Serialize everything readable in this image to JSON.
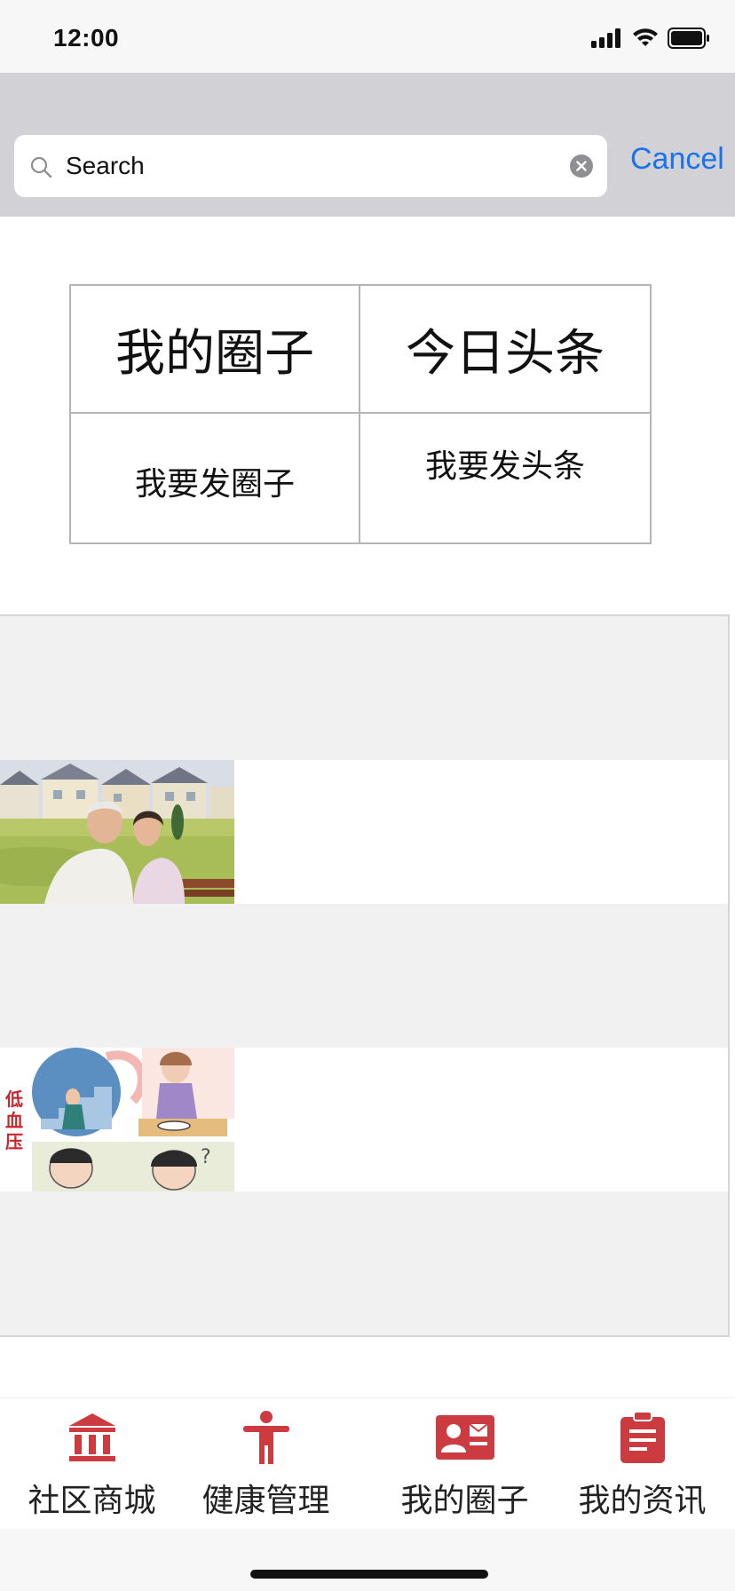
{
  "status_bar": {
    "time": "12:00"
  },
  "search": {
    "placeholder": "Search",
    "cancel_label": "Cancel"
  },
  "grid": {
    "my_circle": "我的圈子",
    "today_headlines": "今日头条",
    "post_circle": "我要发圈子",
    "post_headline": "我要发头条"
  },
  "feed": {
    "items": [
      {
        "thumbnail": "elderly-couple-park-photo"
      },
      {
        "thumbnail": "low-blood-pressure-illustration",
        "thumbnail_text": "低血压"
      }
    ]
  },
  "tabbar": {
    "items": [
      {
        "label": "社区商城",
        "icon": "bank-icon"
      },
      {
        "label": "健康管理",
        "icon": "person-icon"
      },
      {
        "label": "我的圈子",
        "icon": "contact-card-icon"
      },
      {
        "label": "我的资讯",
        "icon": "clipboard-icon"
      }
    ]
  },
  "colors": {
    "accent": "#cc3b3f",
    "link": "#1a73e8",
    "search_bg": "#d1d1d6",
    "feed_bg": "#f1f1f1"
  }
}
